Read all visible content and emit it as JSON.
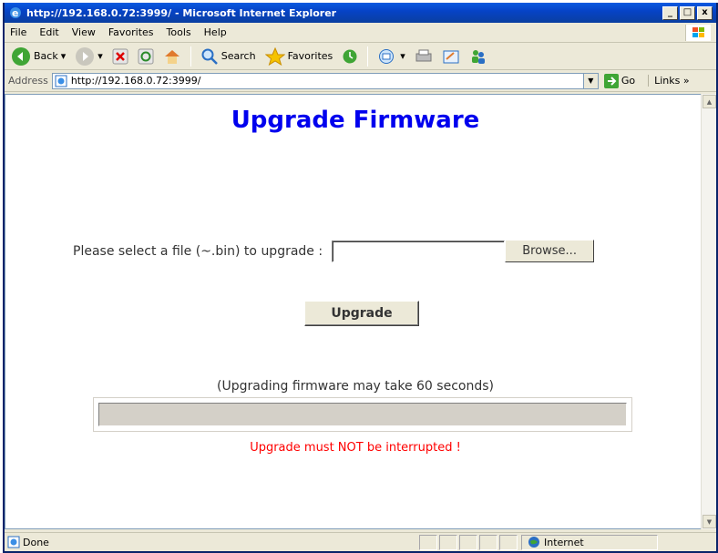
{
  "window": {
    "title": "http://192.168.0.72:3999/ - Microsoft Internet Explorer",
    "minimize": "_",
    "maximize": "□",
    "close": "x"
  },
  "menubar": {
    "items": [
      "File",
      "Edit",
      "View",
      "Favorites",
      "Tools",
      "Help"
    ]
  },
  "toolbar": {
    "back_label": "Back",
    "search_label": "Search",
    "favorites_label": "Favorites"
  },
  "addressbar": {
    "label": "Address",
    "url": "http://192.168.0.72:3999/",
    "go_label": "Go",
    "links_label": "Links »"
  },
  "page": {
    "title": "Upgrade Firmware",
    "select_label": "Please select a file (~.bin) to upgrade :",
    "file_value": "",
    "browse_label": "Browse...",
    "upgrade_label": "Upgrade",
    "note": "(Upgrading firmware may take 60 seconds)",
    "progress": 0,
    "warning": "Upgrade must NOT be interrupted !"
  },
  "statusbar": {
    "status": "Done",
    "zone": "Internet"
  },
  "colors": {
    "title_blue": "#0000ee",
    "warning_red": "#ff0000",
    "titlebar_blue": "#0643c7"
  }
}
